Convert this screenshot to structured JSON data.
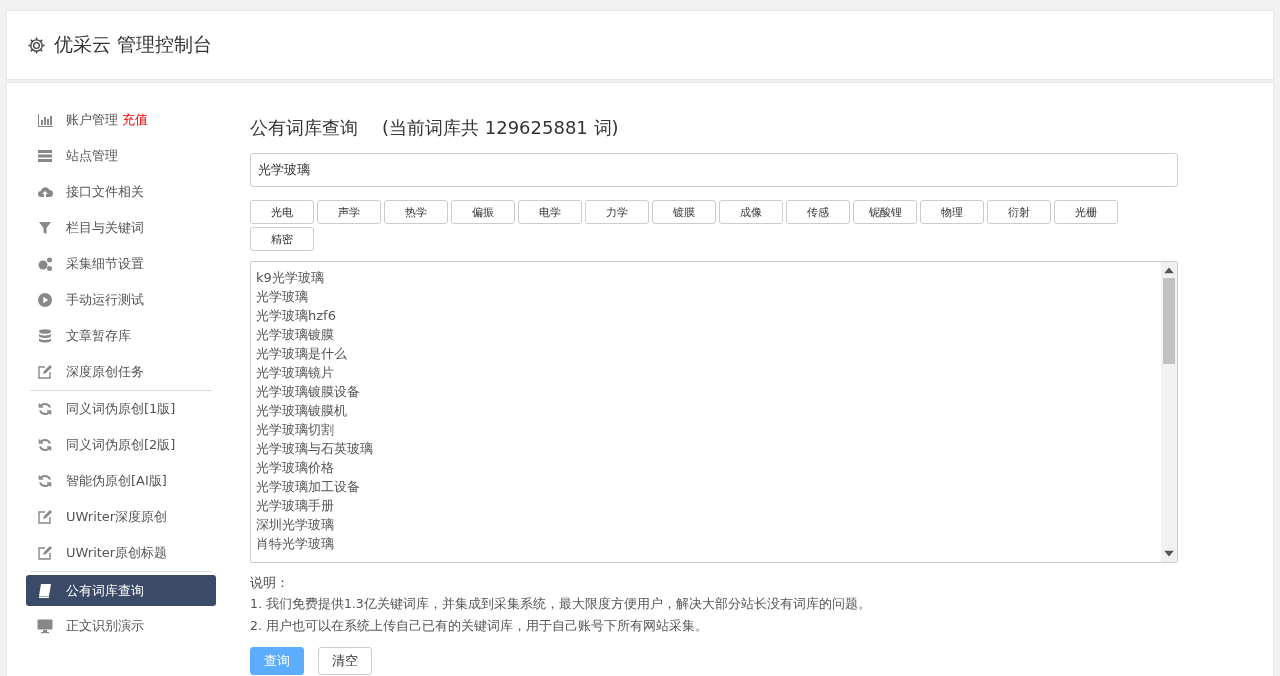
{
  "header": {
    "title": "优采云 管理控制台"
  },
  "sidebar": {
    "items": [
      {
        "label": "账户管理",
        "badge": "充值",
        "selected": false,
        "divider_after": false
      },
      {
        "label": "站点管理",
        "selected": false,
        "divider_after": false
      },
      {
        "label": "接口文件相关",
        "selected": false,
        "divider_after": false
      },
      {
        "label": "栏目与关键词",
        "selected": false,
        "divider_after": false
      },
      {
        "label": "采集细节设置",
        "selected": false,
        "divider_after": false
      },
      {
        "label": "手动运行测试",
        "selected": false,
        "divider_after": false
      },
      {
        "label": "文章暂存库",
        "selected": false,
        "divider_after": false
      },
      {
        "label": "深度原创任务",
        "selected": false,
        "divider_after": true
      },
      {
        "label": "同义词伪原创[1版]",
        "selected": false,
        "divider_after": false
      },
      {
        "label": "同义词伪原创[2版]",
        "selected": false,
        "divider_after": false
      },
      {
        "label": "智能伪原创[AI版]",
        "selected": false,
        "divider_after": false
      },
      {
        "label": "UWriter深度原创",
        "selected": false,
        "divider_after": false
      },
      {
        "label": "UWriter原创标题",
        "selected": false,
        "divider_after": true
      },
      {
        "label": "公有词库查询",
        "selected": true,
        "divider_after": false
      },
      {
        "label": "正文识别演示",
        "selected": false,
        "divider_after": false
      }
    ]
  },
  "main": {
    "title": "公有词库查询",
    "count_note": "(当前词库共 129625881 词)",
    "search": {
      "value": "光学玻璃"
    },
    "tags": [
      "光电",
      "声学",
      "热学",
      "偏振",
      "电学",
      "力学",
      "镀膜",
      "成像",
      "传感",
      "铌酸锂",
      "物理",
      "衍射",
      "光栅",
      "精密"
    ],
    "results": [
      "k9光学玻璃",
      "光学玻璃",
      "光学玻璃hzf6",
      "光学玻璃镀膜",
      "光学玻璃是什么",
      "光学玻璃镜片",
      "光学玻璃镀膜设备",
      "光学玻璃镀膜机",
      "光学玻璃切割",
      "光学玻璃与石英玻璃",
      "光学玻璃价格",
      "光学玻璃加工设备",
      "光学玻璃手册",
      "深圳光学玻璃",
      "肖特光学玻璃"
    ],
    "notes_title": "说明：",
    "notes": [
      "1. 我们免费提供1.3亿关键词库，并集成到采集系统，最大限度方便用户，解决大部分站长没有词库的问题。",
      "2. 用户也可以在系统上传自己已有的关键词库，用于自己账号下所有网站采集。"
    ],
    "buttons": [
      {
        "label": "查询",
        "kind": "primary"
      },
      {
        "label": "清空",
        "kind": "default"
      }
    ]
  }
}
